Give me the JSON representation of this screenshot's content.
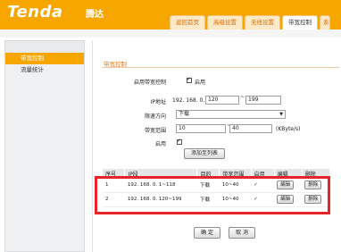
{
  "header": {
    "logo": "Tenda",
    "logo_cn": "腾达",
    "tabs": [
      {
        "label": "返回首页"
      },
      {
        "label": "高级设置"
      },
      {
        "label": "无线设置"
      },
      {
        "label": "带宽控制"
      },
      {
        "label": "系统"
      }
    ]
  },
  "sidebar": {
    "items": [
      {
        "label": "带宽控制"
      },
      {
        "label": "流量统计"
      }
    ]
  },
  "main": {
    "title": "带宽控制",
    "enable_label": "启用带宽控制",
    "enable_value": "启用",
    "ip_label": "IP地址",
    "ip_prefix": "192. 168. 0.",
    "ip_start": "120",
    "ip_sep": "~",
    "ip_end": "199",
    "direction_label": "限速方向",
    "direction_value": "下载",
    "bandwidth_label": "带宽范围",
    "bw_min": "10",
    "bw_sep": "~",
    "bw_max": "40",
    "bw_unit": "(KByte/s)",
    "enable2_label": "启用",
    "add_button": "添加至列表",
    "table": {
      "headers": [
        "序号",
        "IP段",
        "目的",
        "带宽范围",
        "启用",
        "编辑",
        "删除"
      ],
      "rows": [
        {
          "no": "1",
          "ip": "192. 168. 0. 1~118",
          "dir": "下载",
          "bw": "10~40",
          "enabled": "✓",
          "edit": "编辑",
          "del": "删除"
        },
        {
          "no": "2",
          "ip": "192. 168. 0. 120~199",
          "dir": "下载",
          "bw": "10~40",
          "enabled": "✓",
          "edit": "编辑",
          "del": "删除"
        }
      ]
    },
    "ok_button": "确 定",
    "cancel_button": "取 消"
  },
  "colors": {
    "accent": "#f7a600",
    "title": "#e8740c",
    "highlight": "#e8232a"
  }
}
